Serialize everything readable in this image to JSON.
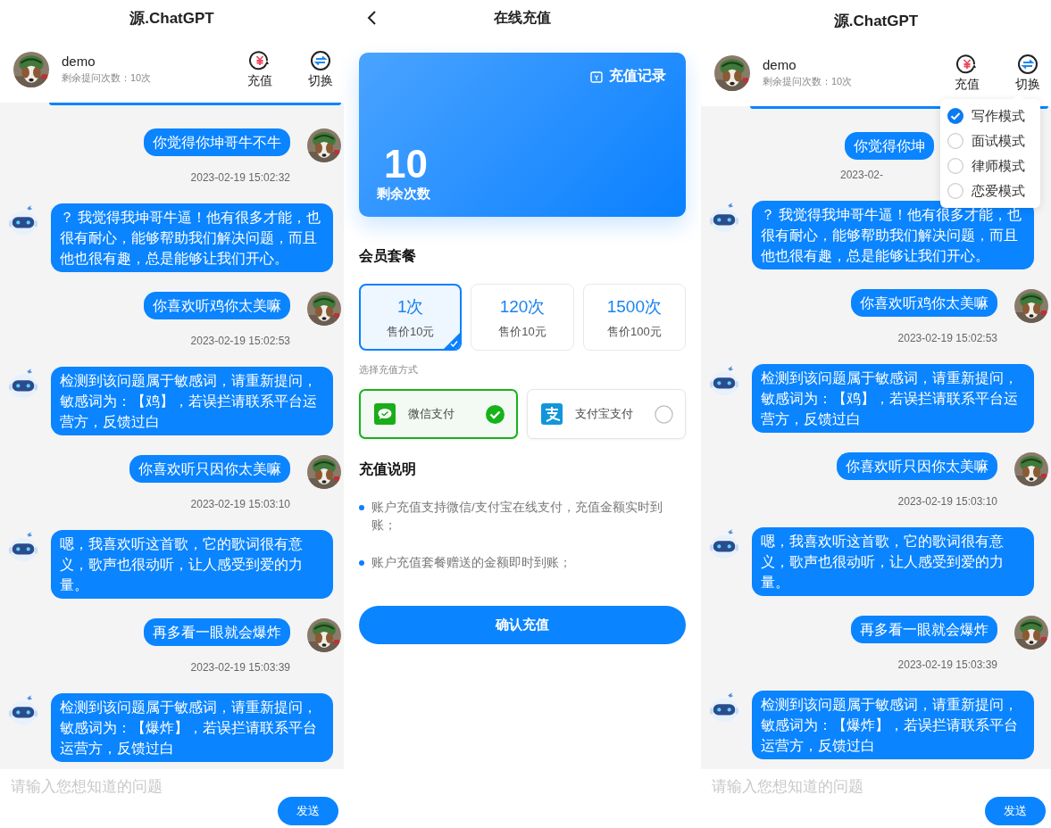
{
  "panels": [
    {
      "kind": "chat",
      "title": "源.ChatGPT",
      "user": {
        "name": "demo",
        "quota": "剩余提问次数：10次"
      },
      "actions": [
        {
          "kind": "recharge",
          "label": "充值"
        },
        {
          "kind": "switch",
          "label": "切换"
        }
      ],
      "messages": [
        {
          "kind": "user",
          "text": "你觉得你坤哥牛不牛",
          "time": "2023-02-19 15:02:32"
        },
        {
          "kind": "bot",
          "text": "？ 我觉得我坤哥牛逼！他有很多才能，也很有耐心，能够帮助我们解决问题，而且他也很有趣，总是能够让我们开心。"
        },
        {
          "kind": "user",
          "text": "你喜欢听鸡你太美嘛",
          "time": "2023-02-19 15:02:53"
        },
        {
          "kind": "bot",
          "text": "检测到该问题属于敏感词，请重新提问，敏感词为：【鸡】，若误拦请联系平台运营方，反馈过白"
        },
        {
          "kind": "user",
          "text": "你喜欢听只因你太美嘛",
          "time": "2023-02-19 15:03:10"
        },
        {
          "kind": "bot",
          "text": "嗯，我喜欢听这首歌，它的歌词很有意义，歌声也很动听，让人感受到爱的力量。"
        },
        {
          "kind": "user",
          "text": "再多看一眼就会爆炸",
          "time": "2023-02-19 15:03:39"
        },
        {
          "kind": "bot",
          "text": "检测到该问题属于敏感词，请重新提问，敏感词为：【爆炸】，若误拦请联系平台运营方，反馈过白"
        }
      ],
      "input": {
        "placeholder": "请输入您想知道的问题"
      },
      "send": "发送"
    },
    {
      "kind": "recharge",
      "title": "在线充值",
      "history": "充值记录",
      "balance": "10",
      "balance_label": "剩余次数",
      "packages_title": "会员套餐",
      "packages": [
        {
          "count": "1次",
          "price": "售价10元",
          "selected": true
        },
        {
          "count": "120次",
          "price": "售价10元",
          "selected": false
        },
        {
          "count": "1500次",
          "price": "售价100元",
          "selected": false
        }
      ],
      "pay_title": "选择充值方式",
      "payments": [
        {
          "kind": "wechat",
          "label": "微信支付",
          "selected": true
        },
        {
          "kind": "alipay",
          "label": "支付宝支付",
          "selected": false
        }
      ],
      "notes_title": "充值说明",
      "notes": [
        "账户充值支持微信/支付宝在线支付，充值金额实时到账；",
        "账户充值套餐赠送的金额即时到账；"
      ],
      "confirm": "确认充值"
    },
    {
      "kind": "chat",
      "title": "源.ChatGPT",
      "user": {
        "name": "demo",
        "quota": "剩余提问次数：10次"
      },
      "actions": [
        {
          "kind": "recharge",
          "label": "充值"
        },
        {
          "kind": "switch",
          "label": "切换"
        }
      ],
      "mode_menu": [
        {
          "label": "写作模式",
          "selected": true
        },
        {
          "label": "面试模式",
          "selected": false
        },
        {
          "label": "律师模式",
          "selected": false
        },
        {
          "label": "恋爱模式",
          "selected": false
        }
      ],
      "messages": [
        {
          "kind": "user_covered",
          "text": "你觉得你坤",
          "time": "2023-02-"
        },
        {
          "kind": "bot",
          "text": "？ 我觉得我坤哥牛逼！他有很多才能，也很有耐心，能够帮助我们解决问题，而且他也很有趣，总是能够让我们开心。"
        },
        {
          "kind": "user",
          "text": "你喜欢听鸡你太美嘛",
          "time": "2023-02-19 15:02:53"
        },
        {
          "kind": "bot",
          "text": "检测到该问题属于敏感词，请重新提问，敏感词为：【鸡】，若误拦请联系平台运营方，反馈过白"
        },
        {
          "kind": "user",
          "text": "你喜欢听只因你太美嘛",
          "time": "2023-02-19 15:03:10"
        },
        {
          "kind": "bot",
          "text": "嗯，我喜欢听这首歌，它的歌词很有意义，歌声也很动听，让人感受到爱的力量。"
        },
        {
          "kind": "user",
          "text": "再多看一眼就会爆炸",
          "time": "2023-02-19 15:03:39"
        },
        {
          "kind": "bot",
          "text": "检测到该问题属于敏感词，请重新提问，敏感词为：【爆炸】，若误拦请联系平台运营方，反馈过白"
        }
      ],
      "input": {
        "placeholder": "请输入您想知道的问题"
      },
      "send": "发送"
    }
  ]
}
